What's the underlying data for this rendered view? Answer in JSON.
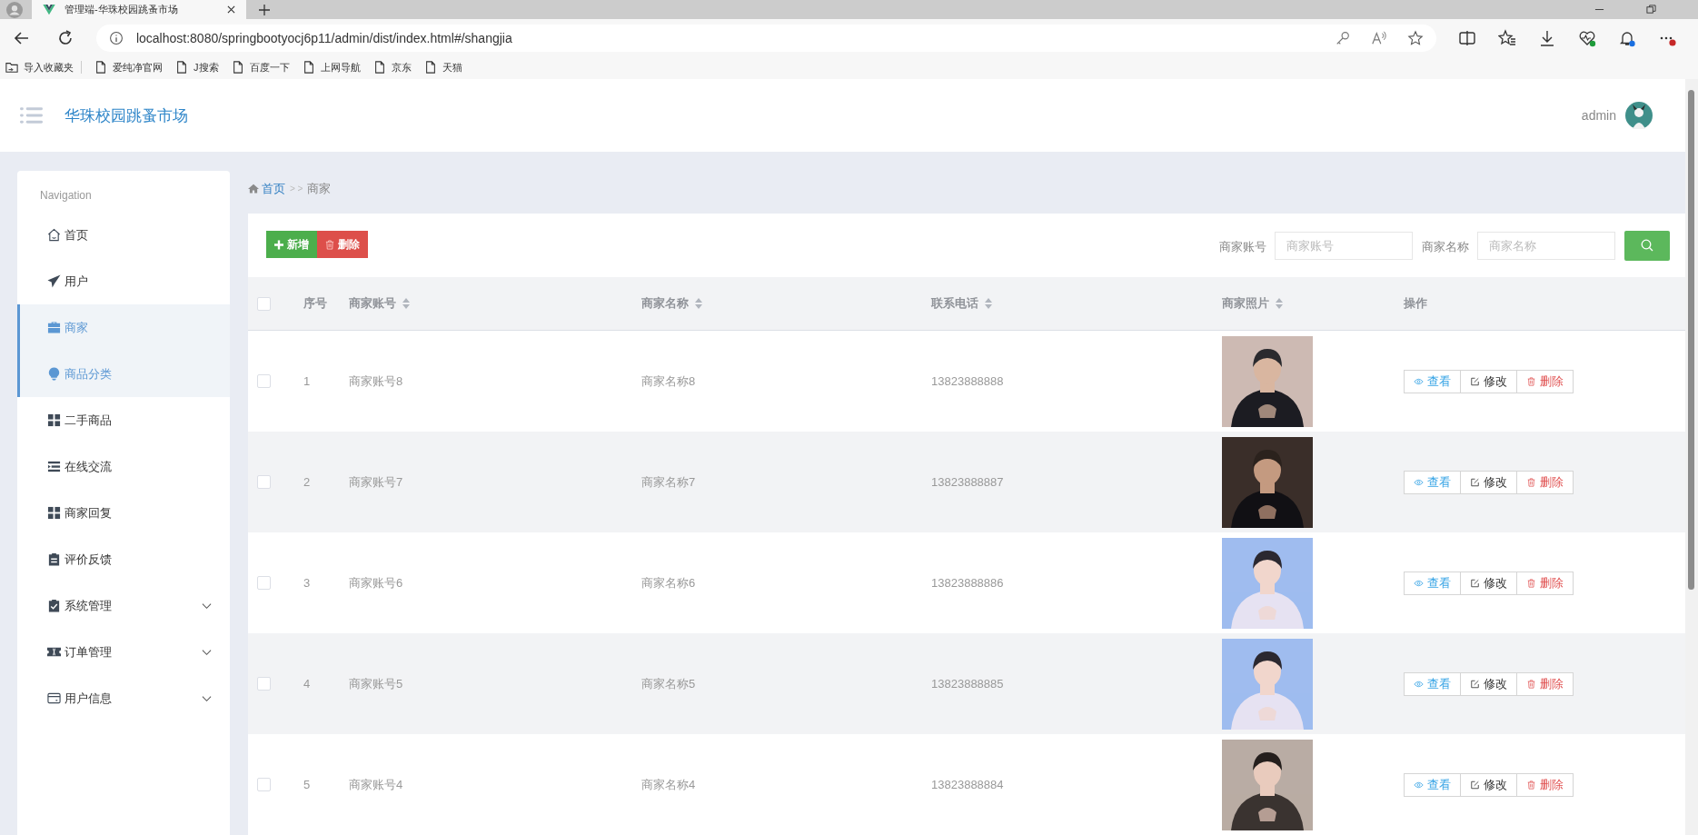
{
  "browser": {
    "tab_title": "管理端-华珠校园跳蚤市场",
    "url": "localhost:8080/springbootyocj6p11/admin/dist/index.html#/shangjia",
    "bookmarks": [
      "导入收藏夹",
      "爱纯净官网",
      "J搜索",
      "百度一下",
      "上网导航",
      "京东",
      "天猫"
    ]
  },
  "header": {
    "title": "华珠校园跳蚤市场",
    "user": "admin"
  },
  "sidebar": {
    "heading": "Navigation",
    "items": [
      {
        "label": "首页",
        "selected": false
      },
      {
        "label": "用户",
        "selected": false
      },
      {
        "label": "商家",
        "selected": true
      },
      {
        "label": "商品分类",
        "selected": true
      },
      {
        "label": "二手商品",
        "selected": false
      },
      {
        "label": "在线交流",
        "selected": false
      },
      {
        "label": "商家回复",
        "selected": false
      },
      {
        "label": "评价反馈",
        "selected": false
      },
      {
        "label": "系统管理",
        "selected": false,
        "expanded": false
      },
      {
        "label": "订单管理",
        "selected": false,
        "expanded": false
      },
      {
        "label": "用户信息",
        "selected": false,
        "expanded": false
      }
    ]
  },
  "breadcrumb": {
    "items": [
      "首页",
      "商家"
    ],
    "separator": "> >"
  },
  "toolbar": {
    "buttons": [
      {
        "label": "新增",
        "kind": "add"
      },
      {
        "label": "删除",
        "kind": "delete"
      }
    ]
  },
  "search": {
    "fields": [
      {
        "label": "商家账号",
        "placeholder": "商家账号"
      },
      {
        "label": "商家名称",
        "placeholder": "商家名称"
      }
    ]
  },
  "table": {
    "all_checked": false,
    "columns": [
      {
        "label": "序号",
        "sortable": false
      },
      {
        "label": "商家账号",
        "sortable": true
      },
      {
        "label": "商家名称",
        "sortable": true
      },
      {
        "label": "联系电话",
        "sortable": true
      },
      {
        "label": "商家照片",
        "sortable": true
      },
      {
        "label": "操作",
        "sortable": false
      }
    ],
    "rows": [
      {
        "checked": false,
        "index": "1",
        "account": "商家账号8",
        "name": "商家名称8",
        "phone": "13823888888",
        "actions": [
          {
            "label": "查看",
            "kind": "view"
          },
          {
            "label": "修改",
            "kind": "edit"
          },
          {
            "label": "删除",
            "kind": "delete"
          }
        ]
      },
      {
        "checked": false,
        "index": "2",
        "account": "商家账号7",
        "name": "商家名称7",
        "phone": "13823888887",
        "actions": [
          {
            "label": "查看",
            "kind": "view"
          },
          {
            "label": "修改",
            "kind": "edit"
          },
          {
            "label": "删除",
            "kind": "delete"
          }
        ]
      },
      {
        "checked": false,
        "index": "3",
        "account": "商家账号6",
        "name": "商家名称6",
        "phone": "13823888886",
        "actions": [
          {
            "label": "查看",
            "kind": "view"
          },
          {
            "label": "修改",
            "kind": "edit"
          },
          {
            "label": "删除",
            "kind": "delete"
          }
        ]
      },
      {
        "checked": false,
        "index": "4",
        "account": "商家账号5",
        "name": "商家名称5",
        "phone": "13823888885",
        "actions": [
          {
            "label": "查看",
            "kind": "view"
          },
          {
            "label": "修改",
            "kind": "edit"
          },
          {
            "label": "删除",
            "kind": "delete"
          }
        ]
      },
      {
        "checked": false,
        "index": "5",
        "account": "商家账号4",
        "name": "商家名称4",
        "phone": "13823888884",
        "actions": [
          {
            "label": "查看",
            "kind": "view"
          },
          {
            "label": "修改",
            "kind": "edit"
          },
          {
            "label": "删除",
            "kind": "delete"
          }
        ]
      }
    ]
  }
}
